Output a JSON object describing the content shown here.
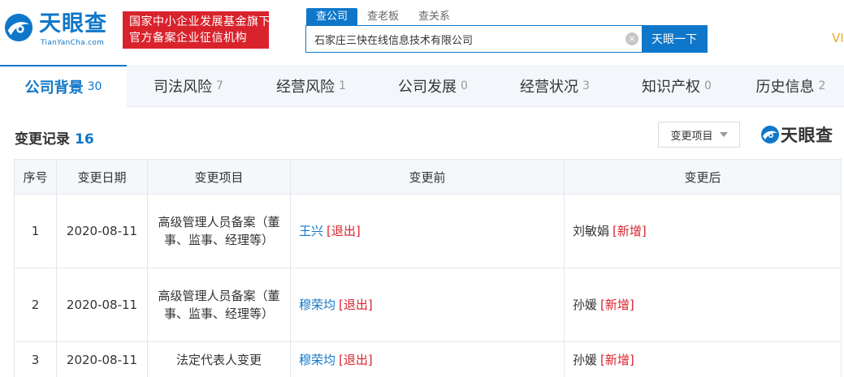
{
  "header": {
    "logo_cn": "天眼查",
    "logo_en": "TianYanCha.com",
    "badge_line1": "国家中小企业发展基金旗下",
    "badge_line2": "官方备案企业征信机构",
    "search_tabs": [
      "查公司",
      "查老板",
      "查关系"
    ],
    "search_value": "石家庄三快在线信息技术有限公司",
    "clear_glyph": "×",
    "search_button": "天眼一下",
    "vip_text": "VI"
  },
  "nav": [
    {
      "label": "公司背景",
      "count": "30"
    },
    {
      "label": "司法风险",
      "count": "7"
    },
    {
      "label": "经营风险",
      "count": "1"
    },
    {
      "label": "公司发展",
      "count": "0"
    },
    {
      "label": "经营状况",
      "count": "3"
    },
    {
      "label": "知识产权",
      "count": "0"
    },
    {
      "label": "历史信息",
      "count": "2"
    }
  ],
  "section": {
    "title": "变更记录",
    "count": "16",
    "filter_label": "变更项目",
    "watermark": "天眼查"
  },
  "table": {
    "headers": [
      "序号",
      "变更日期",
      "变更项目",
      "变更前",
      "变更后"
    ],
    "rows": [
      {
        "index": "1",
        "date": "2020-08-11",
        "item": "高级管理人员备案（董事、监事、经理等）",
        "before_name": "王兴",
        "before_tag": "[退出]",
        "after_name": "刘敏娟",
        "after_tag": "[新增]"
      },
      {
        "index": "2",
        "date": "2020-08-11",
        "item": "高级管理人员备案（董事、监事、经理等）",
        "before_name": "穆荣均",
        "before_tag": "[退出]",
        "after_name": "孙媛",
        "after_tag": "[新增]"
      },
      {
        "index": "3",
        "date": "2020-08-11",
        "item": "法定代表人变更",
        "before_name": "穆荣均",
        "before_tag": "[退出]",
        "after_name": "孙媛",
        "after_tag": "[新增]"
      }
    ]
  },
  "colors": {
    "brand_blue": "#0f77c9",
    "badge_red": "#d9232c",
    "tag_red": "#d9232c",
    "vip_orange": "#f5a623"
  }
}
